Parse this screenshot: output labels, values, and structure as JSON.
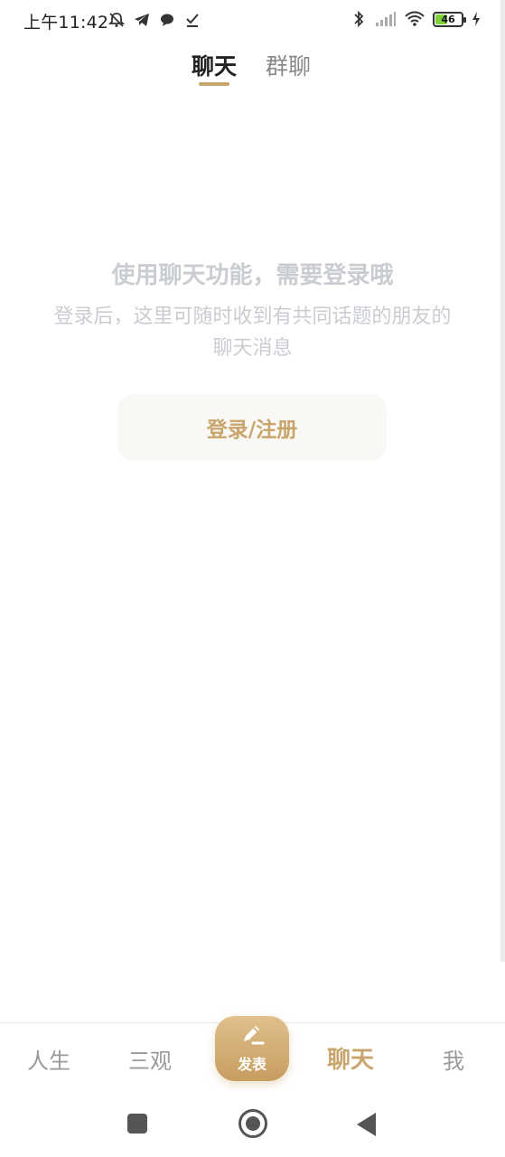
{
  "status_bar": {
    "time": "上午11:42",
    "left_icons": [
      "mute-icon",
      "telegram-icon",
      "chat-bubble-icon",
      "download-done-icon"
    ],
    "right_icons": [
      "bluetooth-icon",
      "signal-icon",
      "wifi-icon",
      "battery-icon",
      "charging-icon"
    ],
    "battery_level": "46",
    "battery_fill_percent": 46,
    "battery_color": "#7dd13b"
  },
  "tabs": [
    {
      "label": "聊天",
      "active": true
    },
    {
      "label": "群聊",
      "active": false
    }
  ],
  "empty_state": {
    "title": "使用聊天功能，需要登录哦",
    "description": "登录后，这里可随时收到有共同话题的朋友的聊天消息",
    "login_button": "登录/注册"
  },
  "bottom_nav": {
    "items": [
      {
        "label": "人生",
        "active": false
      },
      {
        "label": "三观",
        "active": false
      },
      {
        "label": "发表",
        "icon": "pencil-icon"
      },
      {
        "label": "聊天",
        "active": true
      },
      {
        "label": "我",
        "active": false
      }
    ]
  },
  "colors": {
    "accent": "#c9a56e",
    "muted_text": "#c9ccd1"
  },
  "system_nav": [
    "recent-apps-icon",
    "home-icon",
    "back-icon"
  ]
}
